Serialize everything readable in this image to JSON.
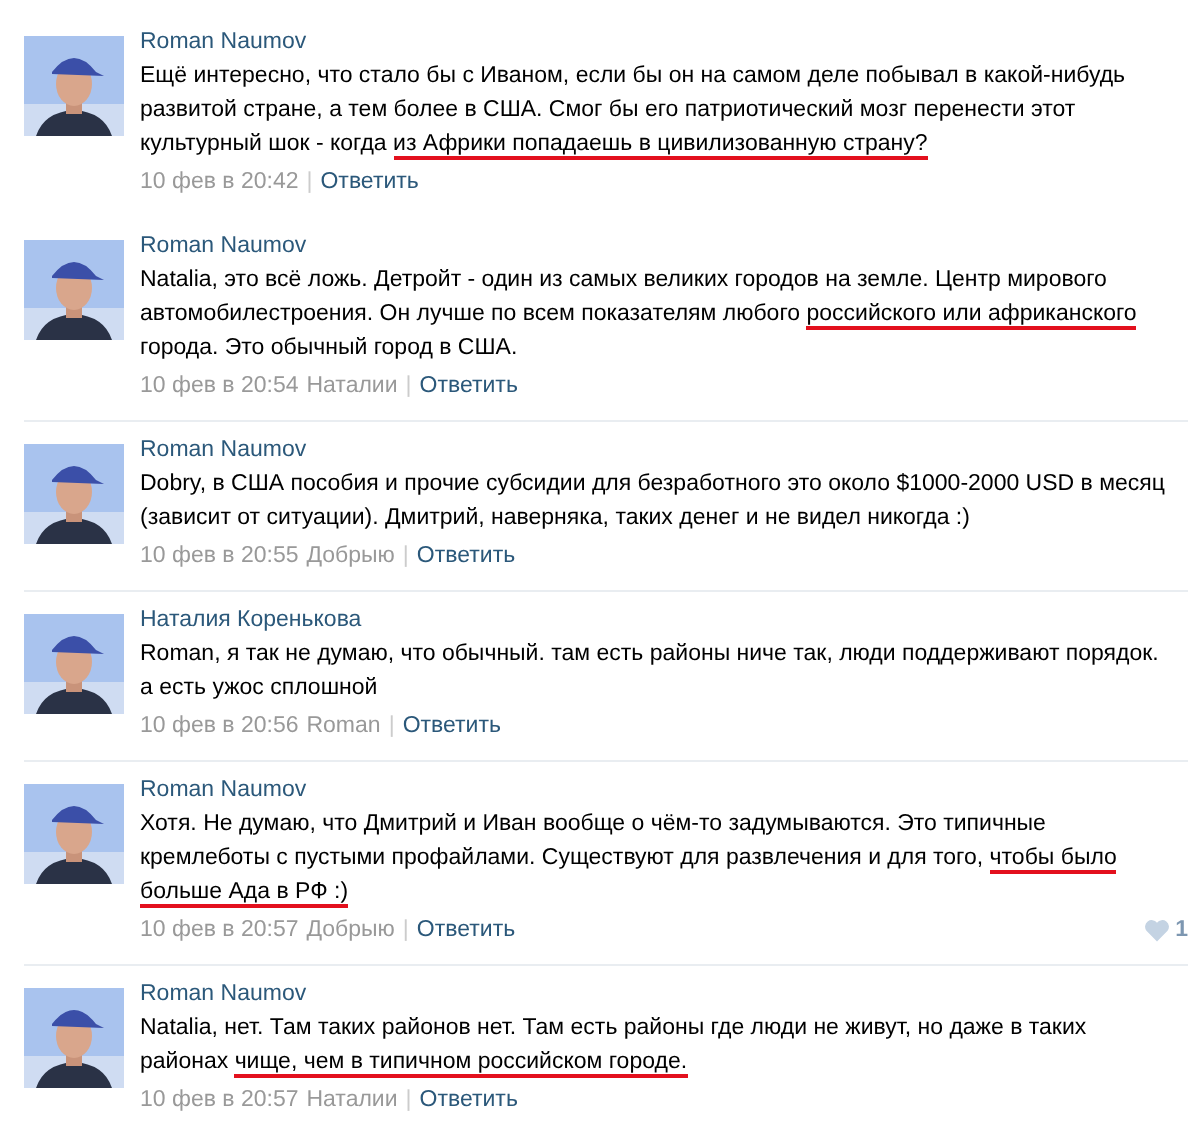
{
  "comments": [
    {
      "author": "Roman Naumov",
      "body": [
        {
          "text": "Ещё интересно, что стало бы с Иваном, если бы он на самом деле побывал в какой-нибудь\nразвитой стране, а тем более в США. Смог бы его патриотический мозг перенести этот\nкультурный шок - когда ",
          "marked": false
        },
        {
          "text": "из Африки попадаешь в цивилизованную страну?",
          "marked": true
        }
      ],
      "date": "10 фев в 20:42",
      "separator": "|",
      "reply": "Ответить"
    },
    {
      "author": "Roman Naumov",
      "body": [
        {
          "text": "Natalia, это всё ложь. Детройт - один из самых великих городов на земле. Центр мирового\nавтомобилестроения. Он лучше по всем показателям любого ",
          "marked": false
        },
        {
          "text": "российского или африканского",
          "marked": true
        },
        {
          "text": "\nгорода. Это обычный город в США.",
          "marked": false
        }
      ],
      "date": "10 фев в 20:54",
      "to": "Наталии",
      "separator": "|",
      "reply": "Ответить"
    },
    {
      "author": "Roman Naumov",
      "body": [
        {
          "text": "Dobry, в США пособия и прочие субсидии для безработного это около $1000-2000 USD в месяц\n(зависит от ситуации). Дмитрий, наверняка, таких денег и не видел никогда :)",
          "marked": false
        }
      ],
      "date": "10 фев в 20:55",
      "to": "Добрыю",
      "separator": "|",
      "reply": "Ответить"
    },
    {
      "author": "Наталия Коренькова",
      "body": [
        {
          "text": "Roman, я так не думаю, что обычный. там есть районы ниче так, люди поддерживают порядок.\nа есть ужос сплошной",
          "marked": false
        }
      ],
      "date": "10 фев в 20:56",
      "to": "Roman",
      "separator": "|",
      "reply": "Ответить"
    },
    {
      "author": "Roman Naumov",
      "body": [
        {
          "text": "Хотя. Не думаю, что Дмитрий и Иван вообще о чём-то задумываются. Это типичные\nкремлеботы с пустыми профайлами. Существуют для развлечения и для того, ",
          "marked": false
        },
        {
          "text": "чтобы было\nбольше Ада в РФ :)",
          "marked": true
        }
      ],
      "date": "10 фев в 20:57",
      "to": "Добрыю",
      "separator": "|",
      "reply": "Ответить",
      "likes": "1"
    },
    {
      "author": "Roman Naumov",
      "body": [
        {
          "text": "Natalia, нет. Там таких районов нет. Там есть районы где люди не живут, но даже в таких\nрайонах ",
          "marked": false
        },
        {
          "text": "чище, чем в типичном российском городе.",
          "marked": true
        }
      ],
      "date": "10 фев в 20:57",
      "to": "Наталии",
      "separator": "|",
      "reply": "Ответить"
    }
  ]
}
